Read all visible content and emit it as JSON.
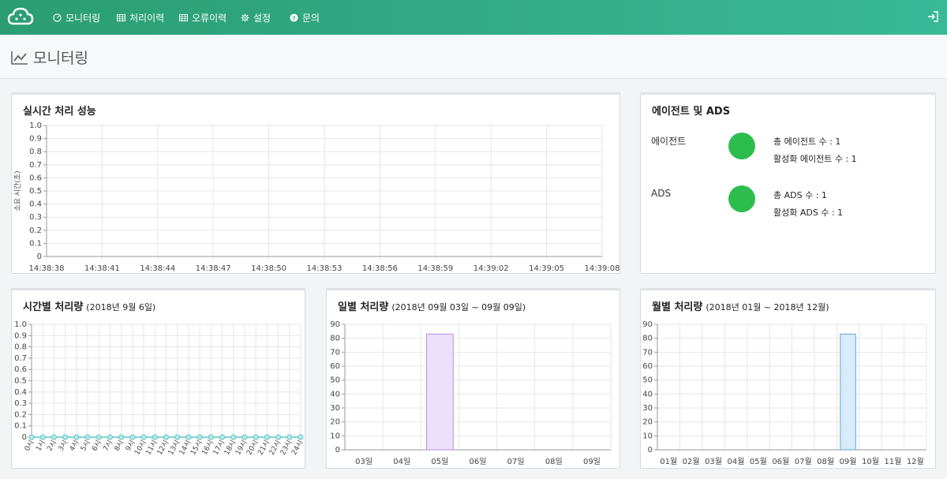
{
  "nav": {
    "items": [
      {
        "label": "모니터링",
        "icon": "dashboard-icon"
      },
      {
        "label": "처리이력",
        "icon": "table-icon"
      },
      {
        "label": "오류이력",
        "icon": "table-icon"
      },
      {
        "label": "설정",
        "icon": "gear-icon"
      },
      {
        "label": "문의",
        "icon": "question-icon"
      }
    ],
    "logo_icon": "cloud-logo-icon",
    "logout_icon": "sign-out-icon"
  },
  "page": {
    "title": "모니터링",
    "title_icon": "line-chart-icon"
  },
  "realtime": {
    "title": "실시간 처리 성능"
  },
  "agents": {
    "title": "에이전트 및 ADS",
    "rows": [
      {
        "label": "에이전트",
        "status_color": "#2dbd4e",
        "stat1": "총 에이전트 수 : 1",
        "stat2": "활성화 에이전트 수 : 1"
      },
      {
        "label": "ADS",
        "status_color": "#2dbd4e",
        "stat1": "총 ADS 수 : 1",
        "stat2": "활성화 ADS 수 : 1"
      }
    ]
  },
  "hourly": {
    "title": "시간별 처리량",
    "subtitle": "(2018년 9월 6일)"
  },
  "daily": {
    "title": "일별 처리량",
    "subtitle": "(2018년 09월 03일 ~ 09월 09일)"
  },
  "monthly": {
    "title": "월별 처리량",
    "subtitle": "(2018년 01월 ~ 2018년 12월)"
  },
  "chart_data": [
    {
      "type": "line",
      "title": "실시간 처리 성능",
      "ylabel": "소요 시간(초)",
      "ylim": [
        0,
        1.0
      ],
      "yticks": [
        "0",
        "0.1",
        "0.2",
        "0.3",
        "0.4",
        "0.5",
        "0.6",
        "0.7",
        "0.8",
        "0.9",
        "1.0"
      ],
      "categories": [
        "14:38:38",
        "14:38:41",
        "14:38:44",
        "14:38:47",
        "14:38:50",
        "14:38:53",
        "14:38:56",
        "14:38:59",
        "14:39:02",
        "14:39:05",
        "14:39:08"
      ],
      "series": [],
      "grid": true
    },
    {
      "type": "line",
      "title": "시간별 처리량",
      "subtitle": "(2018년 9월 6일)",
      "ylim": [
        0,
        1.0
      ],
      "yticks": [
        "0",
        "0.1",
        "0.2",
        "0.3",
        "0.4",
        "0.5",
        "0.6",
        "0.7",
        "0.8",
        "0.9",
        "1.0"
      ],
      "categories": [
        "0시",
        "1시",
        "2시",
        "3시",
        "4시",
        "5시",
        "6시",
        "7시",
        "8시",
        "9시",
        "10시",
        "11시",
        "12시",
        "13시",
        "14시",
        "15시",
        "16시",
        "17시",
        "18시",
        "19시",
        "20시",
        "21시",
        "22시",
        "23시",
        "24시"
      ],
      "series": [
        {
          "values": [
            0,
            0,
            0,
            0,
            0,
            0,
            0,
            0,
            0,
            0,
            0,
            0,
            0,
            0,
            0,
            0,
            0,
            0,
            0,
            0,
            0,
            0,
            0,
            0,
            0
          ],
          "color": "#5bc4c4"
        }
      ],
      "grid": true
    },
    {
      "type": "bar",
      "title": "일별 처리량",
      "subtitle": "(2018년 09월 03일 ~ 09월 09일)",
      "ylim": [
        0,
        90
      ],
      "yticks": [
        "0",
        "10",
        "20",
        "30",
        "40",
        "50",
        "60",
        "70",
        "80",
        "90"
      ],
      "categories": [
        "03일",
        "04일",
        "05일",
        "06일",
        "07일",
        "08일",
        "09일"
      ],
      "values": [
        0,
        0,
        83,
        0,
        0,
        0,
        0
      ],
      "fill": "#ece0fb",
      "stroke": "#b58ee8",
      "grid": true
    },
    {
      "type": "bar",
      "title": "월별 처리량",
      "subtitle": "(2018년 01월 ~ 2018년 12월)",
      "ylim": [
        0,
        90
      ],
      "yticks": [
        "0",
        "10",
        "20",
        "30",
        "40",
        "50",
        "60",
        "70",
        "80",
        "90"
      ],
      "categories": [
        "01월",
        "02월",
        "03월",
        "04월",
        "05월",
        "06월",
        "07월",
        "08월",
        "09월",
        "10월",
        "11월",
        "12월"
      ],
      "values": [
        0,
        0,
        0,
        0,
        0,
        0,
        0,
        0,
        83,
        0,
        0,
        0
      ],
      "fill": "#d8ebfa",
      "stroke": "#5ba7e0",
      "grid": true
    }
  ]
}
